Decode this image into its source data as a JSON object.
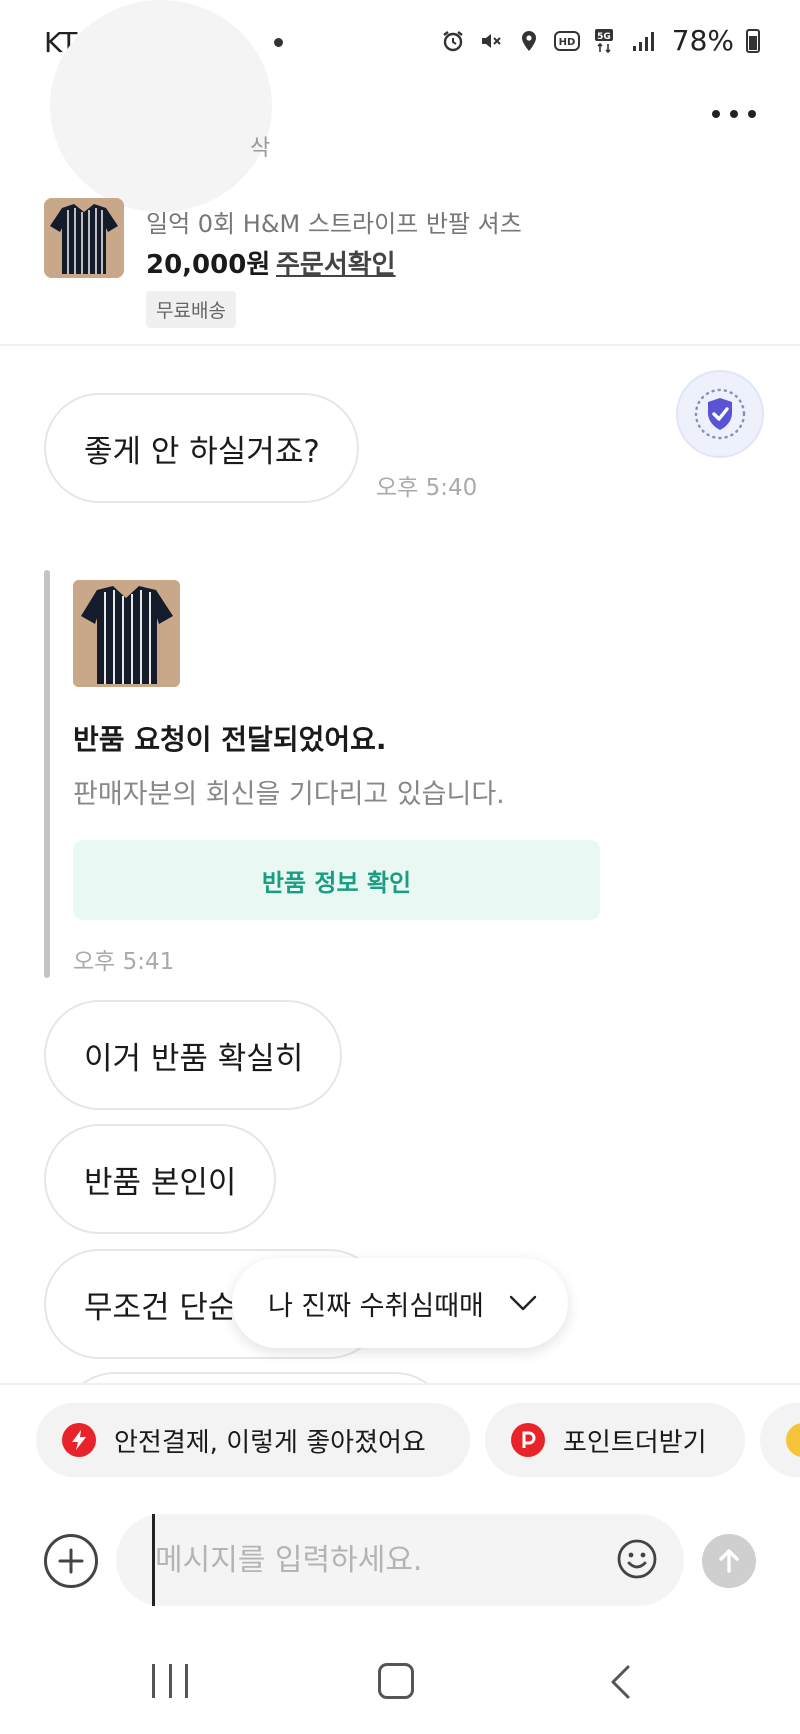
{
  "status_bar": {
    "carrier": "KT",
    "battery": "78%"
  },
  "header": {
    "seller_sub": "삭"
  },
  "product": {
    "title": "일억 0회 H&M 스트라이프 반팔 셔츠",
    "price": "20,000원",
    "order_link": "주문서확인",
    "shipping_badge": "무료배송"
  },
  "messages": {
    "m1": {
      "text": "좋게 안 하실거죠?",
      "time": "오후 5:40"
    },
    "m2": {
      "text": "이거 반품 확실히"
    },
    "m3": {
      "text": "반품 본인이"
    },
    "m4": {
      "text": "무조건 단순"
    }
  },
  "system_card": {
    "title": "반품 요청이 전달되었어요.",
    "description": "판매자분의 회신을 기다리고 있습니다.",
    "button_label": "반품 정보 확인",
    "time": "오후 5:41"
  },
  "floating_chip": {
    "text": "나 진짜 수취심때매"
  },
  "promos": {
    "p1": "안전결제, 이렇게 좋아졌어요",
    "p2": "포인트더받기"
  },
  "composer": {
    "placeholder": "메시지를 입력하세요."
  },
  "colors": {
    "accent_green": "#1a9e83",
    "accent_purple": "#5b53d6",
    "promo_red": "#e8232a"
  }
}
